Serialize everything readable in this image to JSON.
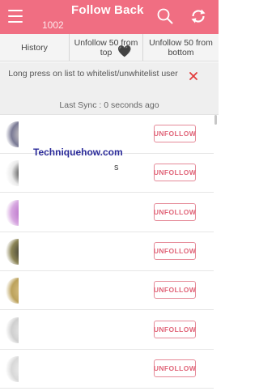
{
  "app_bar": {
    "title": "Follow Back",
    "count": "1002",
    "background": "#f06e82",
    "icons": [
      "menu-icon",
      "search-icon",
      "sync-icon"
    ]
  },
  "tabs": [
    {
      "label": "History"
    },
    {
      "label": "Unfollow 50 from top"
    },
    {
      "label": "Unfollow 50 from bottom"
    }
  ],
  "info": {
    "message": "Long press on list to whitelist/unwhitelist user",
    "close_icon": "close-icon",
    "last_sync": "Last Sync : 0 seconds ago"
  },
  "list": {
    "button_label": "UNFOLLOW",
    "rows": [
      {
        "avatar_colors": [
          "#ffffff",
          "#e8e2d8",
          "#7a7a95"
        ]
      },
      {
        "avatar_colors": [
          "#ffffff",
          "#111111",
          "#e9e9e9"
        ]
      },
      {
        "avatar_colors": [
          "#ffffff",
          "#b061c2",
          "#d7a7e0"
        ]
      },
      {
        "avatar_colors": [
          "#ffffff",
          "#2a2a2a",
          "#8b8456"
        ]
      },
      {
        "avatar_colors": [
          "#ffffff",
          "#e0c890",
          "#bca25c"
        ]
      },
      {
        "avatar_colors": [
          "#ffffff",
          "#ededed",
          "#cfcfcf"
        ]
      },
      {
        "avatar_colors": [
          "#ffffff",
          "#f3f3f3",
          "#d8d8d8"
        ]
      }
    ],
    "heart_glyph": "🖤",
    "row_fragment": "s"
  },
  "watermark": "Techniquehow.com"
}
